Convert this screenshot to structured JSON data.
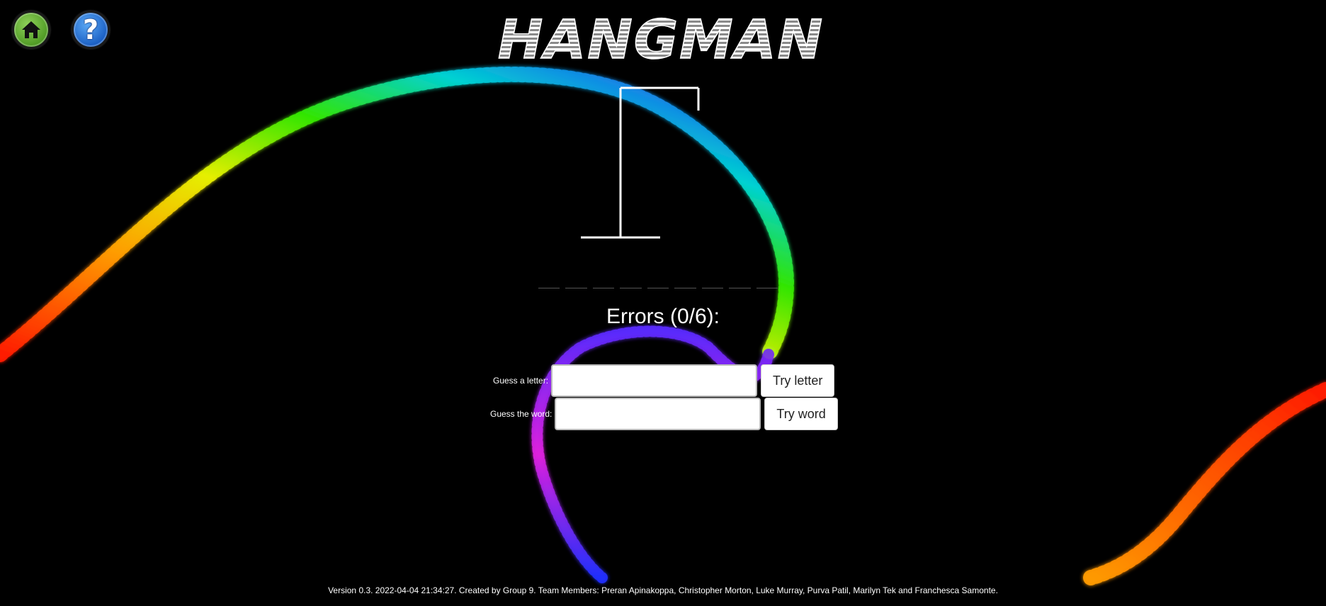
{
  "title": "HANGMAN",
  "nav": {
    "home_icon": "home-icon",
    "help_icon": "help-icon",
    "help_glyph": "?"
  },
  "game": {
    "errors_label": "Errors (0/6):",
    "word_slot_count": 9,
    "letter": {
      "label": "Guess a letter:",
      "value": "",
      "button": "Try letter"
    },
    "word": {
      "label": "Guess the word:",
      "value": "",
      "button": "Try word"
    }
  },
  "footer": "Version 0.3. 2022-04-04 21:34:27. Created by Group 9. Team Members: Preran Apinakoppa, Christopher Morton, Luke Murray, Purva Patil, Marilyn Tek and Franchesca Samonte.",
  "colors": {
    "background": "#000000",
    "home": "#5aa52f",
    "help": "#1f6fd6"
  }
}
